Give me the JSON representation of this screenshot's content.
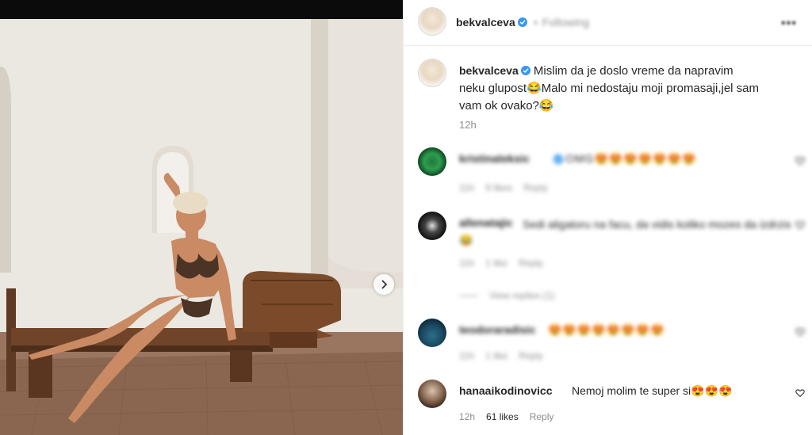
{
  "post": {
    "author": "bekvalceva",
    "header_follow": "Following",
    "more": "•••",
    "caption_text": "Mislim da je doslo vreme da napravim neku glupost😂Malo mi nedostaju moji promasaji,jel sam vam ok ovako?😂",
    "caption_time": "12h"
  },
  "comments": [
    {
      "user": "kristinaleksic",
      "text": "OMG😍😍😍😍😍😍😍",
      "time": "11h",
      "likes": "9 likes",
      "reply": "Reply",
      "blurred": true
    },
    {
      "user": "allenatajic",
      "text": "Sedi aligatoru na facu, da vidis koliko mozes da izdrzis 😂",
      "time": "11h",
      "likes": "1 like",
      "reply": "Reply",
      "blurred": true,
      "view_replies": "View replies (1)"
    },
    {
      "user": "teodoraradisic",
      "text": "😍😍😍😍😍😍😍😍",
      "time": "11h",
      "likes": "1 like",
      "reply": "Reply",
      "blurred": true
    },
    {
      "user": "hanaaikodinovicc",
      "text": "Nemoj molim te super si😍😍😍",
      "time": "12h",
      "likes": "61 likes",
      "reply": "Reply",
      "blurred": false
    }
  ],
  "icons": {
    "verified": "verified-badge-icon",
    "heart": "heart-icon",
    "next": "chevron-right-icon"
  },
  "colors": {
    "verified": "#3897f0",
    "secondary_text": "#8e8e8e",
    "primary_text": "#262626",
    "divider": "#efefef"
  }
}
